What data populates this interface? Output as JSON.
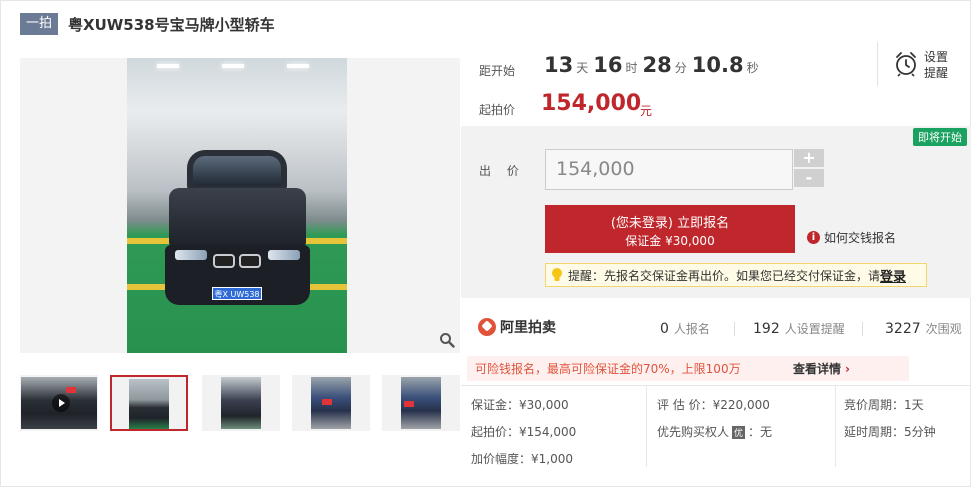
{
  "title": {
    "tag": "一拍",
    "text": "粤XUW538号宝马牌小型轿车"
  },
  "main_image": {
    "plate_text": "粤X UW538",
    "zoom_icon": "magnifier-icon"
  },
  "thumbnails": [
    {
      "kind": "video"
    },
    {
      "kind": "front",
      "active": true
    },
    {
      "kind": "front-three-quarter"
    },
    {
      "kind": "side"
    },
    {
      "kind": "side-rear"
    }
  ],
  "countdown": {
    "label": "距开始",
    "days": "13",
    "days_unit": "天",
    "hours": "16",
    "hours_unit": "时",
    "minutes": "28",
    "minutes_unit": "分",
    "seconds": "10.8",
    "seconds_unit": "秒"
  },
  "remind": {
    "label": "设置提醒",
    "icon": "alarm-clock-icon"
  },
  "starting_price": {
    "label": "起拍价",
    "value": "154,000",
    "unit": "元"
  },
  "bid": {
    "badge": "即将开始",
    "label": "出 价",
    "input_value": "154,000",
    "plus": "+",
    "minus": "-",
    "signup_line1": "(您未登录) 立即报名",
    "signup_line2": "保证金 ¥30,000",
    "how_to_pay": "如何交钱报名",
    "tip_prefix": "提醒：先报名交保证金再出价。如果您已经交付保证金，请",
    "tip_login": "登录"
  },
  "stats": {
    "logo": "阿里拍卖",
    "signups_count": "0",
    "signups_label": "人报名",
    "reminders_count": "192",
    "reminders_label": "人设置提醒",
    "views_count": "3227",
    "views_label": "次围观"
  },
  "risk": {
    "text": "可险钱报名，最高可险保证金的70%，上限100万",
    "link": "查看详情",
    "arrow": "›"
  },
  "details": {
    "deposit": "保证金：¥30,000",
    "starting": "起拍价：¥154,000",
    "increment": "加价幅度：¥1,000",
    "appraisal": "评 估 价：¥220,000",
    "priority_label": "优先购买权人",
    "priority_badge": "优",
    "priority_value": "：无",
    "cycle": "竞价周期：1天",
    "delay": "延时周期：5分钟"
  },
  "colors": {
    "accent": "#c0272d",
    "badge_green": "#1aa260",
    "tag_bg": "#6b7b95"
  }
}
